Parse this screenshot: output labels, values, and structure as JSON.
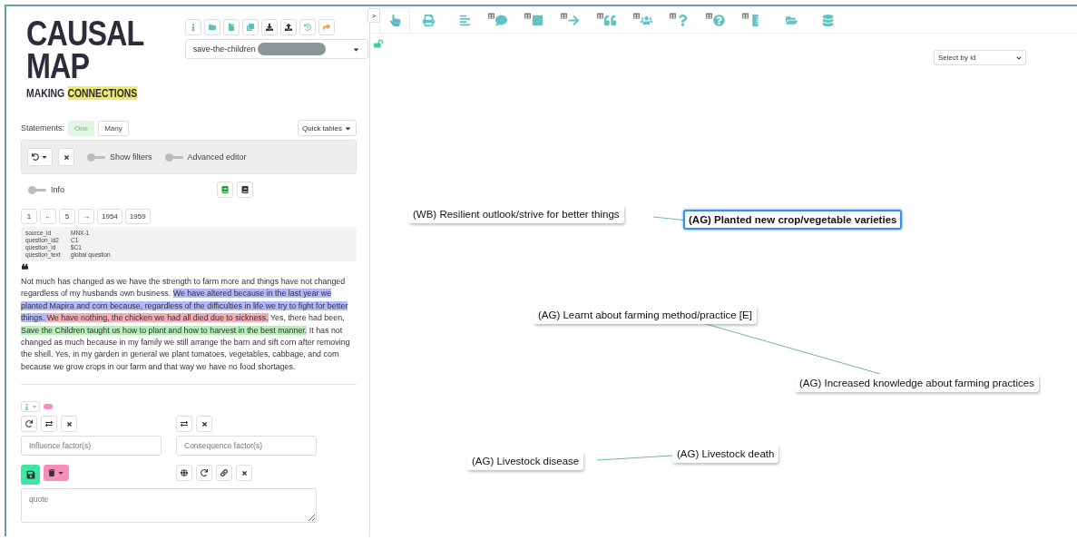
{
  "logo": {
    "line_1": "CAUSAL",
    "line_2": "MAP",
    "tagline": "MAKING",
    "tagline_highlight": "CONNECTIONS"
  },
  "project_select": {
    "value": "save-the-children"
  },
  "statements": {
    "label": "Statements:",
    "options": [
      {
        "label": "One",
        "selected": true
      },
      {
        "label": "Many",
        "selected": false
      }
    ],
    "quick_tables": "Quick tables"
  },
  "filter_toggles": [
    {
      "label": "Show filters",
      "on": false
    },
    {
      "label": "Advanced editor",
      "on": false
    }
  ],
  "info_toggle": {
    "label": "Info",
    "on": false
  },
  "pagination": [
    "1",
    "←",
    "5",
    "→",
    "1954",
    "1959"
  ],
  "metadata": [
    {
      "key": "source_id",
      "value": "MNX-1"
    },
    {
      "key": "question_id2",
      "value": "C1"
    },
    {
      "key": "question_id",
      "value": "$C1"
    },
    {
      "key": "question_text",
      "value": "global question"
    }
  ],
  "quote_mark": "❝",
  "statement_segments": [
    {
      "text": "Not much has changed as we have the strength to farm more and things have not changed regardless of my husbands own business. "
    },
    {
      "text": "We have altered because in the last year we planted Mapira and corn because, regardless of the difficulties in life we try to fight for better things. ",
      "color": "#b4b8f6"
    },
    {
      "text": "We have nothing, the chicken we had all died due to sickness.",
      "color": "#f6aab2"
    },
    {
      "text": " Yes, there had been, "
    },
    {
      "text": "Save the Children taught us how to plant and how to harvest in the best manner.",
      "color": "#b2f2b4"
    },
    {
      "text": " It has not changed as much because in my family we still arrange the barn and sift corn after removing the shell. Yes, in my garden in general we plant tomatoes, vegetables, cabbage, and corn because we grow crops in our farm and that way we have no food shortages."
    }
  ],
  "coding": {
    "influence_placeholder": "Influence factor(s)",
    "consequence_placeholder": "Consequence factor(s)",
    "quote_placeholder": "quote"
  },
  "collapse_button": ">",
  "toolbar_tabs": [
    {
      "selected": true
    },
    {
      "selected": false
    },
    {
      "selected": false
    },
    {
      "selected": false
    },
    {
      "selected": false
    },
    {
      "selected": false
    },
    {
      "selected": false
    },
    {
      "selected": false
    },
    {
      "selected": false
    },
    {
      "selected": false
    },
    {
      "selected": false
    },
    {
      "selected": false
    },
    {
      "selected": false
    }
  ],
  "select_by_id": {
    "placeholder": "Select by id"
  },
  "map_nodes": [
    {
      "label": "(WB) Resilient outlook/strive for better things",
      "selected": false
    },
    {
      "label": "(AG) Planted new crop/vegetable varieties",
      "selected": true
    },
    {
      "label": "(AG) Learnt about farming method/practice [E]",
      "selected": false
    },
    {
      "label": "(AG) Increased knowledge about farming practices",
      "selected": false
    },
    {
      "label": "(AG) Livestock disease",
      "selected": false
    },
    {
      "label": "(AG) Livestock death",
      "selected": false
    }
  ]
}
